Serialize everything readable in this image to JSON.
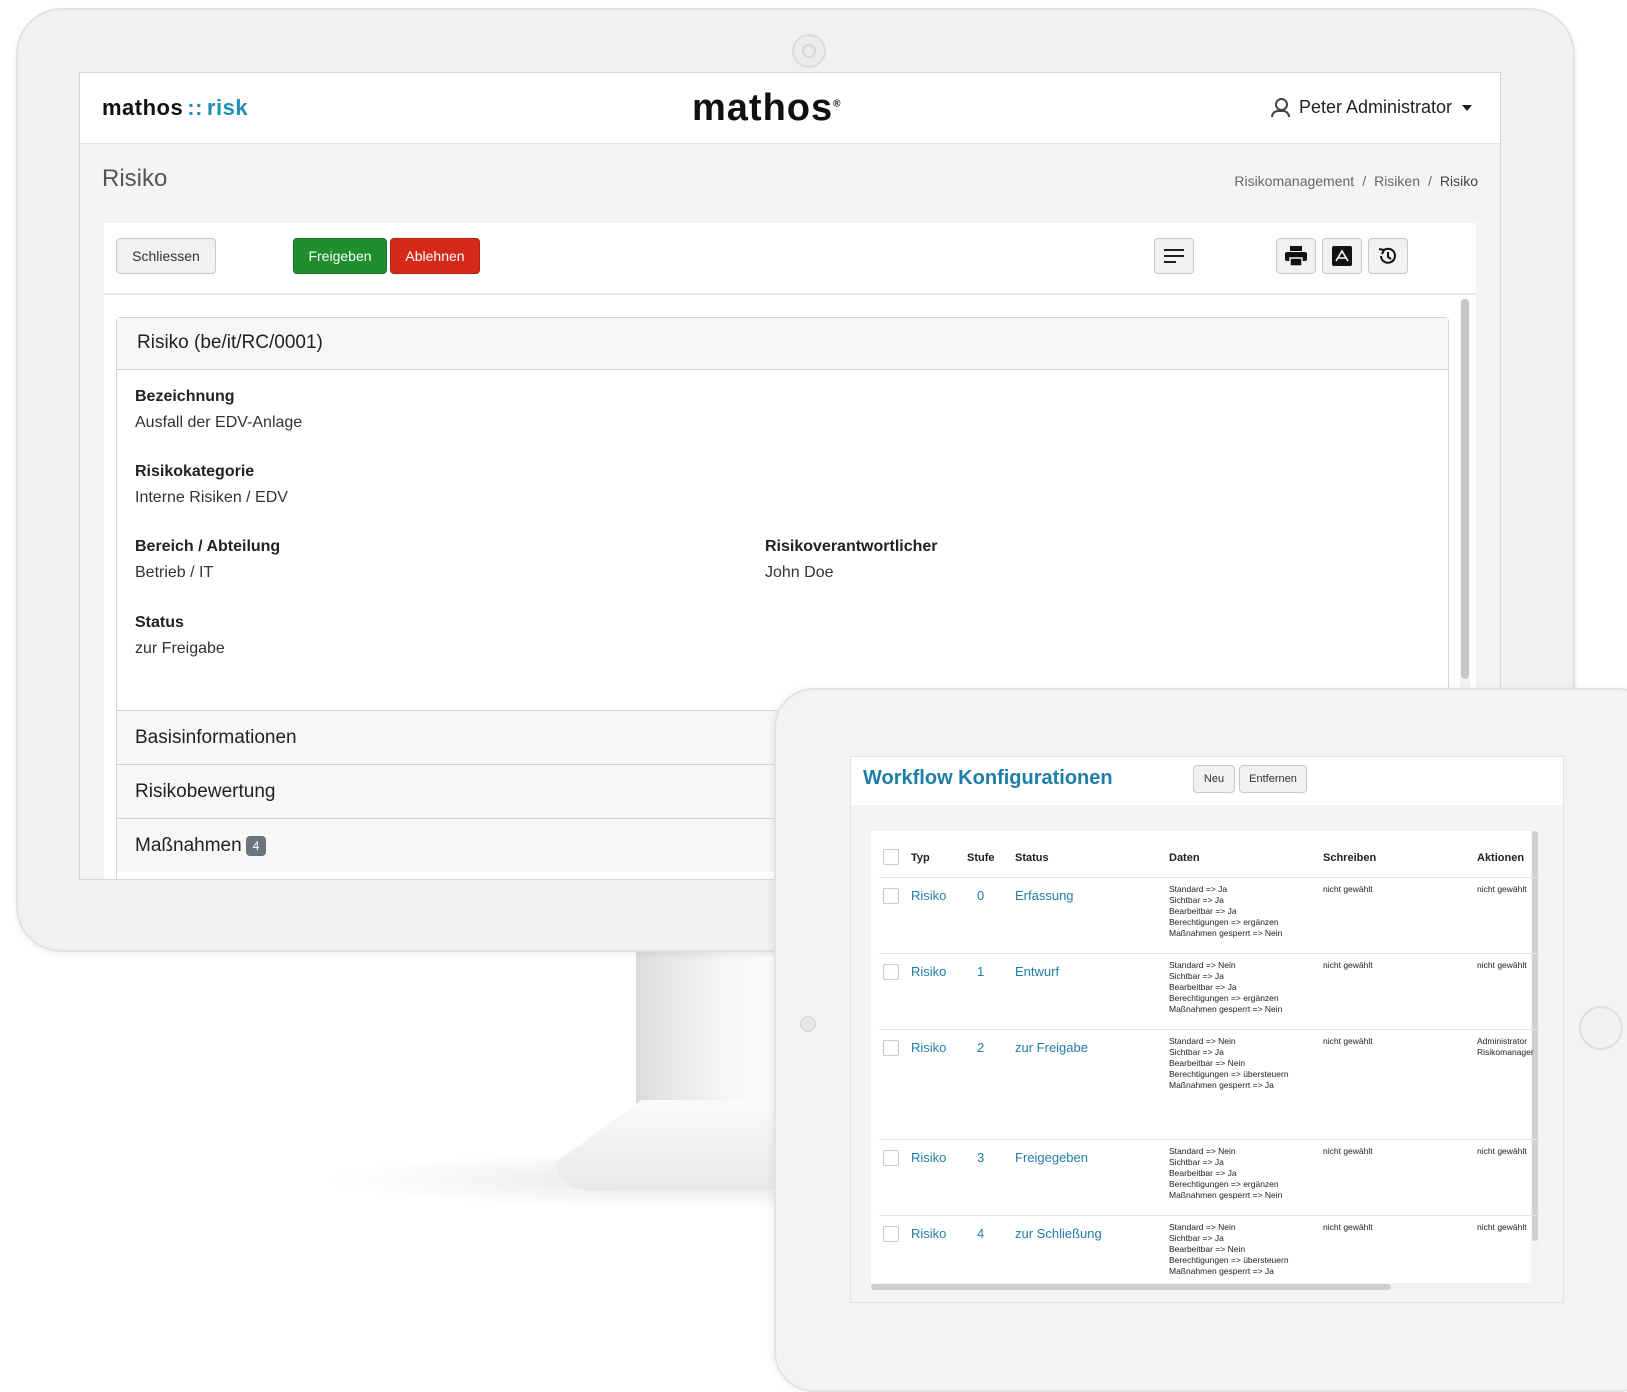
{
  "header": {
    "logo_small": "mathos",
    "logo_small_sep": "::",
    "logo_small_product": "risk",
    "logo_center": "mathos",
    "logo_center_mark": "®",
    "user_name": "Peter Administrator",
    "user_icon": "user-icon"
  },
  "page": {
    "title": "Risiko",
    "breadcrumb": [
      "Risikomanagement",
      "Risiken",
      "Risiko"
    ],
    "breadcrumb_sep": "/"
  },
  "toolbar": {
    "close_label": "Schliessen",
    "approve_label": "Freigeben",
    "reject_label": "Ablehnen",
    "icons": [
      "menu-lines-icon",
      "print-icon",
      "pdf-icon",
      "history-icon"
    ]
  },
  "card": {
    "title": "Risiko (be/it/RC/0001)",
    "fields": {
      "bezeichnung_label": "Bezeichnung",
      "bezeichnung_value": "Ausfall der EDV-Anlage",
      "kategorie_label": "Risikokategorie",
      "kategorie_value": "Interne Risiken / EDV",
      "bereich_label": "Bereich / Abteilung",
      "bereich_value": "Betrieb / IT",
      "verantwortlicher_label": "Risikoverantwortlicher",
      "verantwortlicher_value": "John Doe",
      "status_label": "Status",
      "status_value": "zur Freigabe"
    },
    "sections": [
      {
        "label": "Basisinformationen"
      },
      {
        "label": "Risikobewertung"
      },
      {
        "label": "Maßnahmen",
        "badge": "4"
      }
    ]
  },
  "workflow": {
    "title": "Workflow Konfigurationen",
    "new_label": "Neu",
    "remove_label": "Entfernen",
    "columns": [
      "Typ",
      "Stufe",
      "Status",
      "Daten",
      "Schreiben",
      "Aktionen"
    ],
    "rows": [
      {
        "typ": "Risiko",
        "stufe": "0",
        "status": "Erfassung",
        "daten": [
          "Standard => Ja",
          "Sichtbar => Ja",
          "Bearbeitbar => Ja",
          "Berechtigungen => ergänzen",
          "Maßnahmen gesperrt => Nein"
        ],
        "schreiben": "nicht gewählt",
        "aktionen": [
          "nicht gewählt"
        ]
      },
      {
        "typ": "Risiko",
        "stufe": "1",
        "status": "Entwurf",
        "daten": [
          "Standard => Nein",
          "Sichtbar => Ja",
          "Bearbeitbar => Ja",
          "Berechtigungen => ergänzen",
          "Maßnahmen gesperrt => Nein"
        ],
        "schreiben": "nicht gewählt",
        "aktionen": [
          "nicht gewählt"
        ]
      },
      {
        "typ": "Risiko",
        "stufe": "2",
        "status": "zur Freigabe",
        "daten": [
          "Standard => Nein",
          "Sichtbar => Ja",
          "Bearbeitbar => Nein",
          "Berechtigungen => übersteuern",
          "Maßnahmen gesperrt => Ja"
        ],
        "schreiben": "nicht gewählt",
        "aktionen": [
          "Administrator",
          "Risikomanager"
        ]
      },
      {
        "typ": "Risiko",
        "stufe": "3",
        "status": "Freigegeben",
        "daten": [
          "Standard => Nein",
          "Sichtbar => Ja",
          "Bearbeitbar => Ja",
          "Berechtigungen => ergänzen",
          "Maßnahmen gesperrt => Nein"
        ],
        "schreiben": "nicht gewählt",
        "aktionen": [
          "nicht gewählt"
        ]
      },
      {
        "typ": "Risiko",
        "stufe": "4",
        "status": "zur Schließung",
        "daten": [
          "Standard => Nein",
          "Sichtbar => Ja",
          "Bearbeitbar => Nein",
          "Berechtigungen => übersteuern",
          "Maßnahmen gesperrt => Ja"
        ],
        "schreiben": "nicht gewählt",
        "aktionen": [
          "nicht gewählt"
        ]
      }
    ]
  },
  "colors": {
    "accent": "#1f7ea8",
    "approve": "#1e8e2e",
    "reject": "#d52a1a"
  }
}
